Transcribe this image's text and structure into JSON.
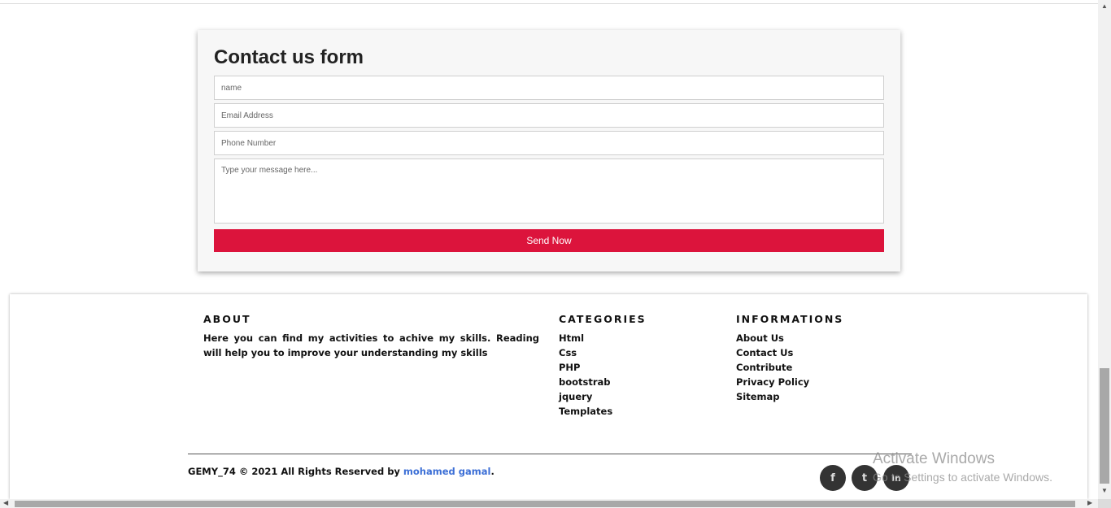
{
  "contact_form": {
    "title": "Contact us form",
    "name_placeholder": "name",
    "email_placeholder": "Email Address",
    "phone_placeholder": "Phone Number",
    "message_placeholder": "Type your message here...",
    "submit_label": "Send Now",
    "submit_color": "#dc143c"
  },
  "footer": {
    "about": {
      "title": "ABOUT",
      "text": "Here you can find my activities to achive my skills. Reading will help you to improve your understanding my skills"
    },
    "categories": {
      "title": "CATEGORIES",
      "items": [
        "Html",
        "Css",
        "PHP",
        "bootstrab",
        "jquery",
        "Templates"
      ]
    },
    "informations": {
      "title": "INFORMATIONS",
      "items": [
        "About Us",
        "Contact Us",
        "Contribute",
        "Privacy Policy",
        "Sitemap"
      ]
    },
    "copyright_prefix": "GEMY_74 © 2021 All Rights Reserved by ",
    "copyright_author": "mohamed gamal",
    "copyright_suffix": ".",
    "author_link_color": "#3c6fd6",
    "social": {
      "facebook_glyph": "f",
      "twitter_glyph": "t",
      "linkedin_glyph": "in"
    }
  },
  "watermark": {
    "title": "Activate Windows",
    "subtitle": "Go to Settings to activate Windows."
  },
  "scrollbar": {
    "up_arrow": "▲",
    "down_arrow": "▼",
    "left_arrow": "◀",
    "right_arrow": "▶"
  }
}
